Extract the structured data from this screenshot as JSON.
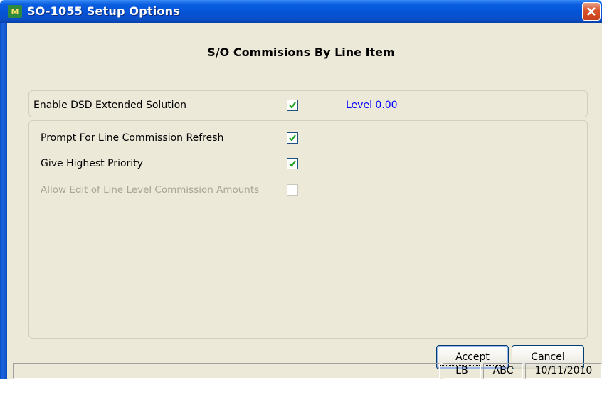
{
  "window": {
    "title": "SO-1055 Setup Options",
    "app_icon": "mas-app-icon",
    "close_icon": "close-x-icon"
  },
  "heading": "S/O Commisions By Line Item",
  "extended_solution": {
    "label": "Enable DSD Extended Solution",
    "checked": true,
    "level_label": "Level",
    "level_value": "0.00"
  },
  "options": [
    {
      "label": "Prompt For Line Commission Refresh",
      "checked": true,
      "enabled": true
    },
    {
      "label": "Give Highest Priority",
      "checked": true,
      "enabled": true
    },
    {
      "label": "Allow Edit of Line Level Commission Amounts",
      "checked": false,
      "enabled": false
    }
  ],
  "buttons": {
    "accept": "Accept",
    "accept_mnemonic": "A",
    "cancel": "Cancel",
    "cancel_mnemonic": "C"
  },
  "status": {
    "user": "LB",
    "company": "ABC",
    "date": "10/11/2010"
  },
  "colors": {
    "title_bar": "#0553d6",
    "client_bg": "#ece9d8",
    "level_text": "#0000ff",
    "disabled_text": "#a6a596"
  }
}
